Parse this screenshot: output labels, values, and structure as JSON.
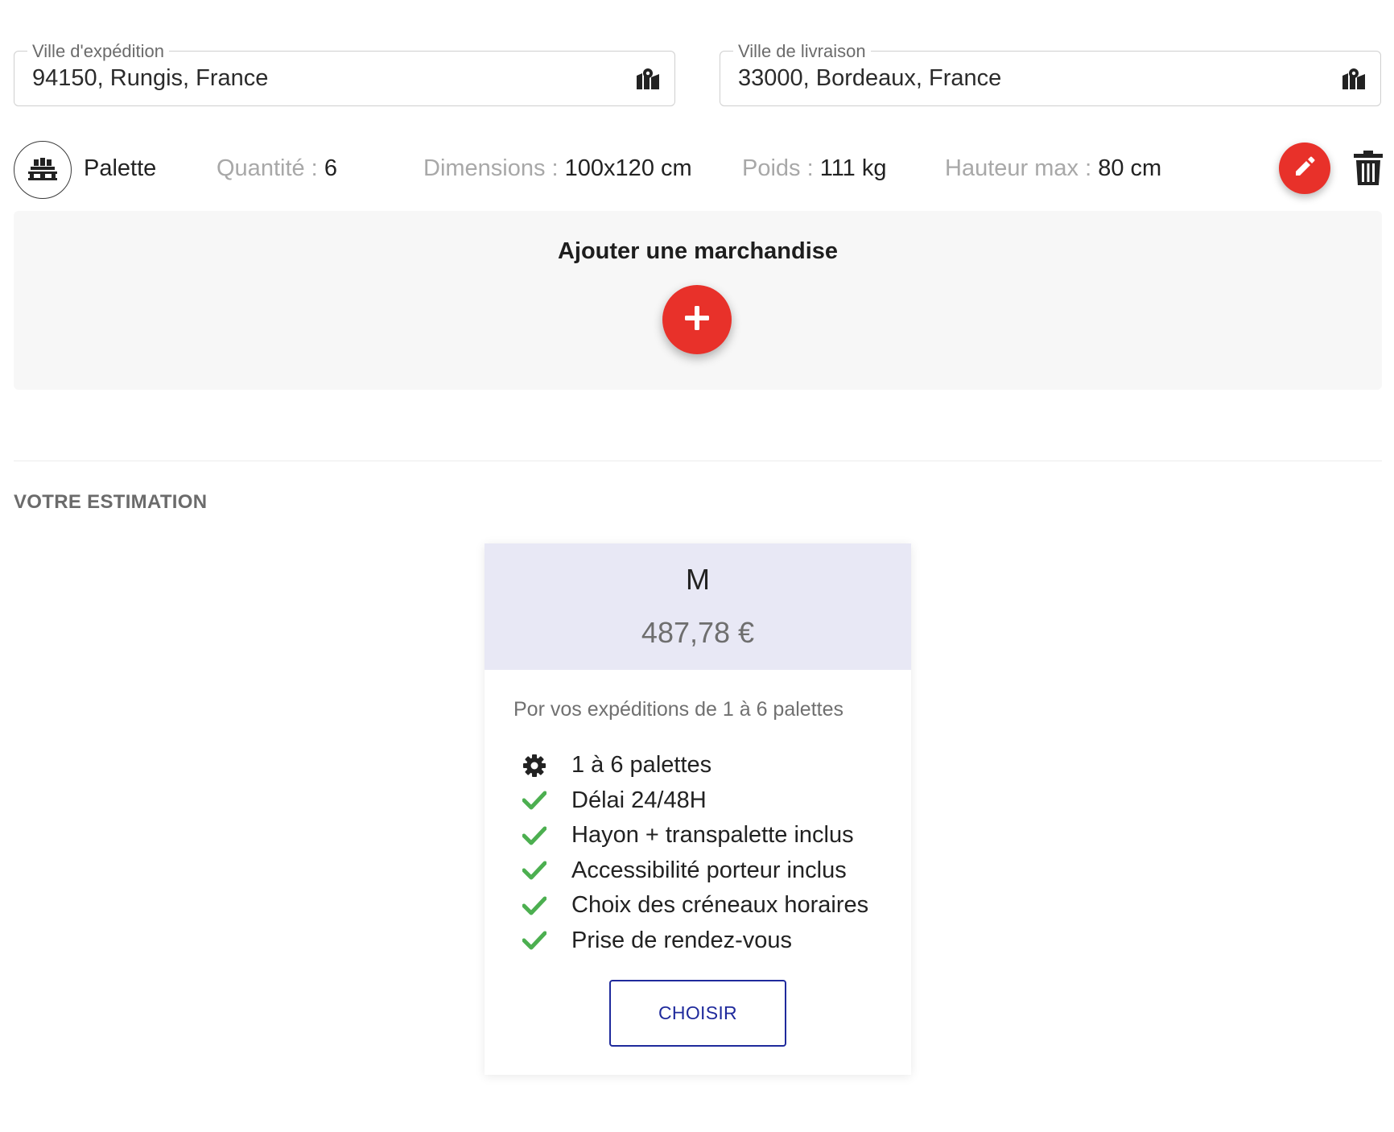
{
  "route": {
    "origin": {
      "label": "Ville d'expédition",
      "value": "94150, Rungis, France",
      "icon": "map-icon"
    },
    "destination": {
      "label": "Ville de livraison",
      "value": "33000, Bordeaux, France",
      "icon": "map-icon"
    }
  },
  "goods": {
    "type": "Palette",
    "icon": "pallet-icon",
    "quantity_label": "Quantité : ",
    "quantity": "6",
    "dimensions_label": "Dimensions : ",
    "dimensions": "100x120 cm",
    "weight_label": "Poids : ",
    "weight": "111 kg",
    "height_label": "Hauteur max : ",
    "height": "80 cm"
  },
  "add_goods": {
    "title": "Ajouter une marchandise"
  },
  "estimation": {
    "section_title": "VOTRE ESTIMATION",
    "plan": {
      "name": "M",
      "price": "487,78 €",
      "description": "Por vos expéditions de 1 à 6 palettes",
      "features": [
        {
          "icon": "gear-icon",
          "text": "1 à 6 palettes"
        },
        {
          "icon": "check-icon",
          "text": "Délai 24/48H"
        },
        {
          "icon": "check-icon",
          "text": "Hayon + transpalette inclus"
        },
        {
          "icon": "check-icon",
          "text": "Accessibilité porteur inclus"
        },
        {
          "icon": "check-icon",
          "text": "Choix des créneaux horaires"
        },
        {
          "icon": "check-icon",
          "text": "Prise de rendez-vous"
        }
      ],
      "button_label": "CHOISIR"
    }
  },
  "colors": {
    "accent_red": "#e8312a",
    "primary_blue": "#1f2a9c",
    "check_green": "#4caf50",
    "card_header": "#e8e8f5"
  }
}
